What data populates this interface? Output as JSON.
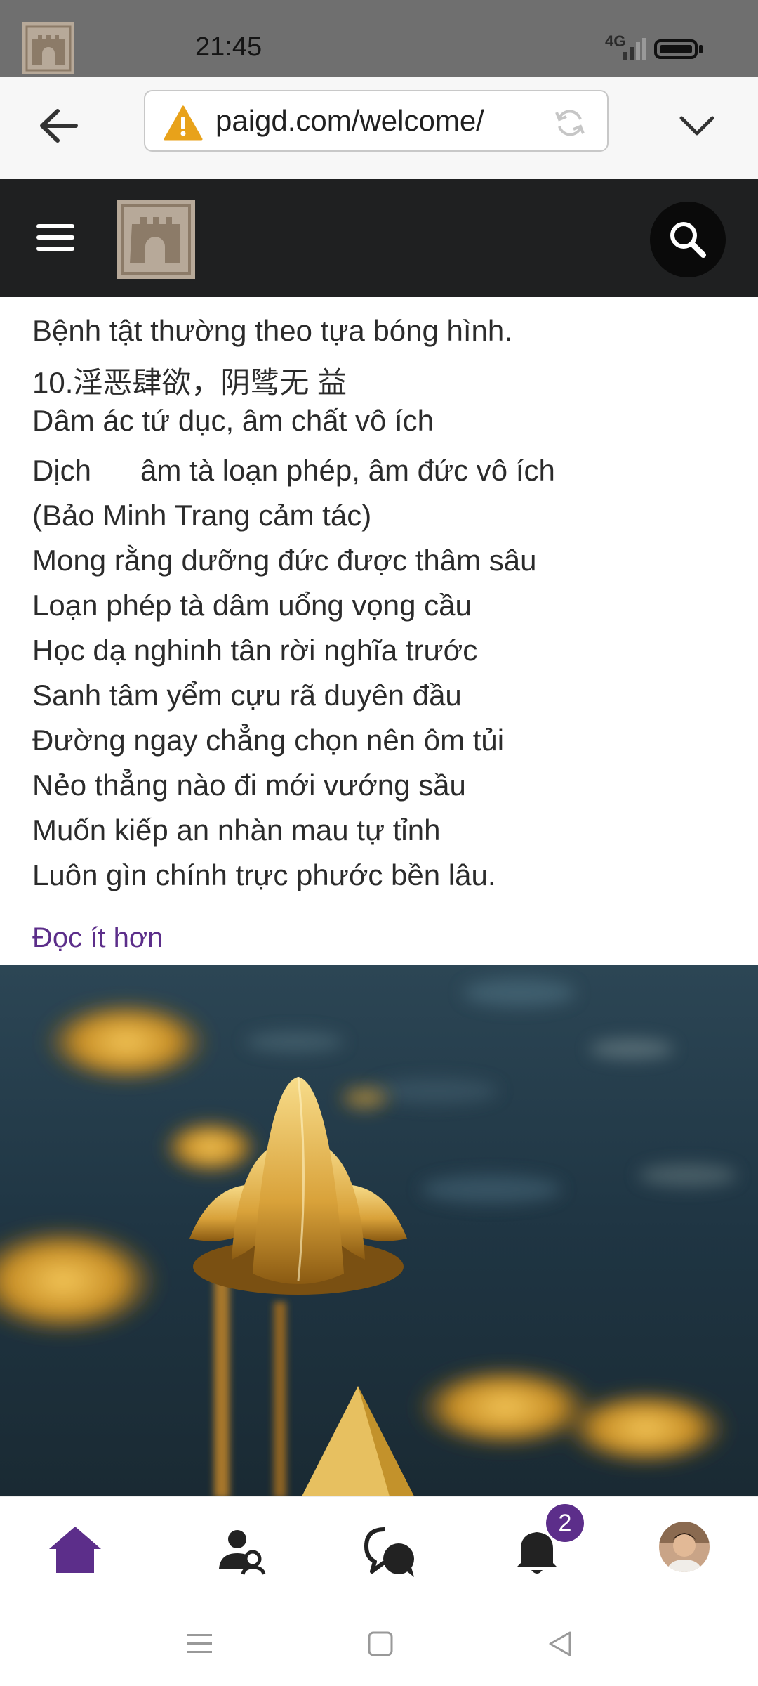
{
  "status_bar": {
    "time": "21:45",
    "network": "4G"
  },
  "browser": {
    "url": "paigd.com/welcome/"
  },
  "content": {
    "verses": [
      "Bệnh tật thường theo tựa bóng hình.",
      "10.淫恶肆欲，阴骘无 益",
      "Dâm ác tứ dục, âm chất vô ích",
      "Dịch      âm tà loạn phép, âm đức vô ích",
      "(Bảo Minh Trang cảm tác)",
      "Mong rằng dưỡng đức được thâm sâu",
      "Loạn phép tà dâm uổng vọng cầu",
      "Học dạ nghinh tân rời nghĩa trước",
      "Sanh tâm yểm cựu rã duyên đầu",
      "Đường ngay chẳng chọn nên ôm tủi",
      "Nẻo thẳng nào đi mới vướng sầu",
      "Muốn kiếp an nhàn mau tự tỉnh",
      "Luôn gìn chính trực phước bền lâu."
    ],
    "read_less": "Đọc ít hơn"
  },
  "bottom_nav": {
    "items": [
      {
        "icon": "home-icon"
      },
      {
        "icon": "friends-icon"
      },
      {
        "icon": "chat-icon"
      },
      {
        "icon": "bell-icon"
      },
      {
        "icon": "avatar"
      }
    ],
    "notification_count": "2",
    "accent": "#5c2e8a"
  },
  "colors": {
    "header_bg": "#1f2021",
    "status_bg": "#6f6f6f",
    "link": "#5c2e8a",
    "logo": "#b7a999"
  }
}
